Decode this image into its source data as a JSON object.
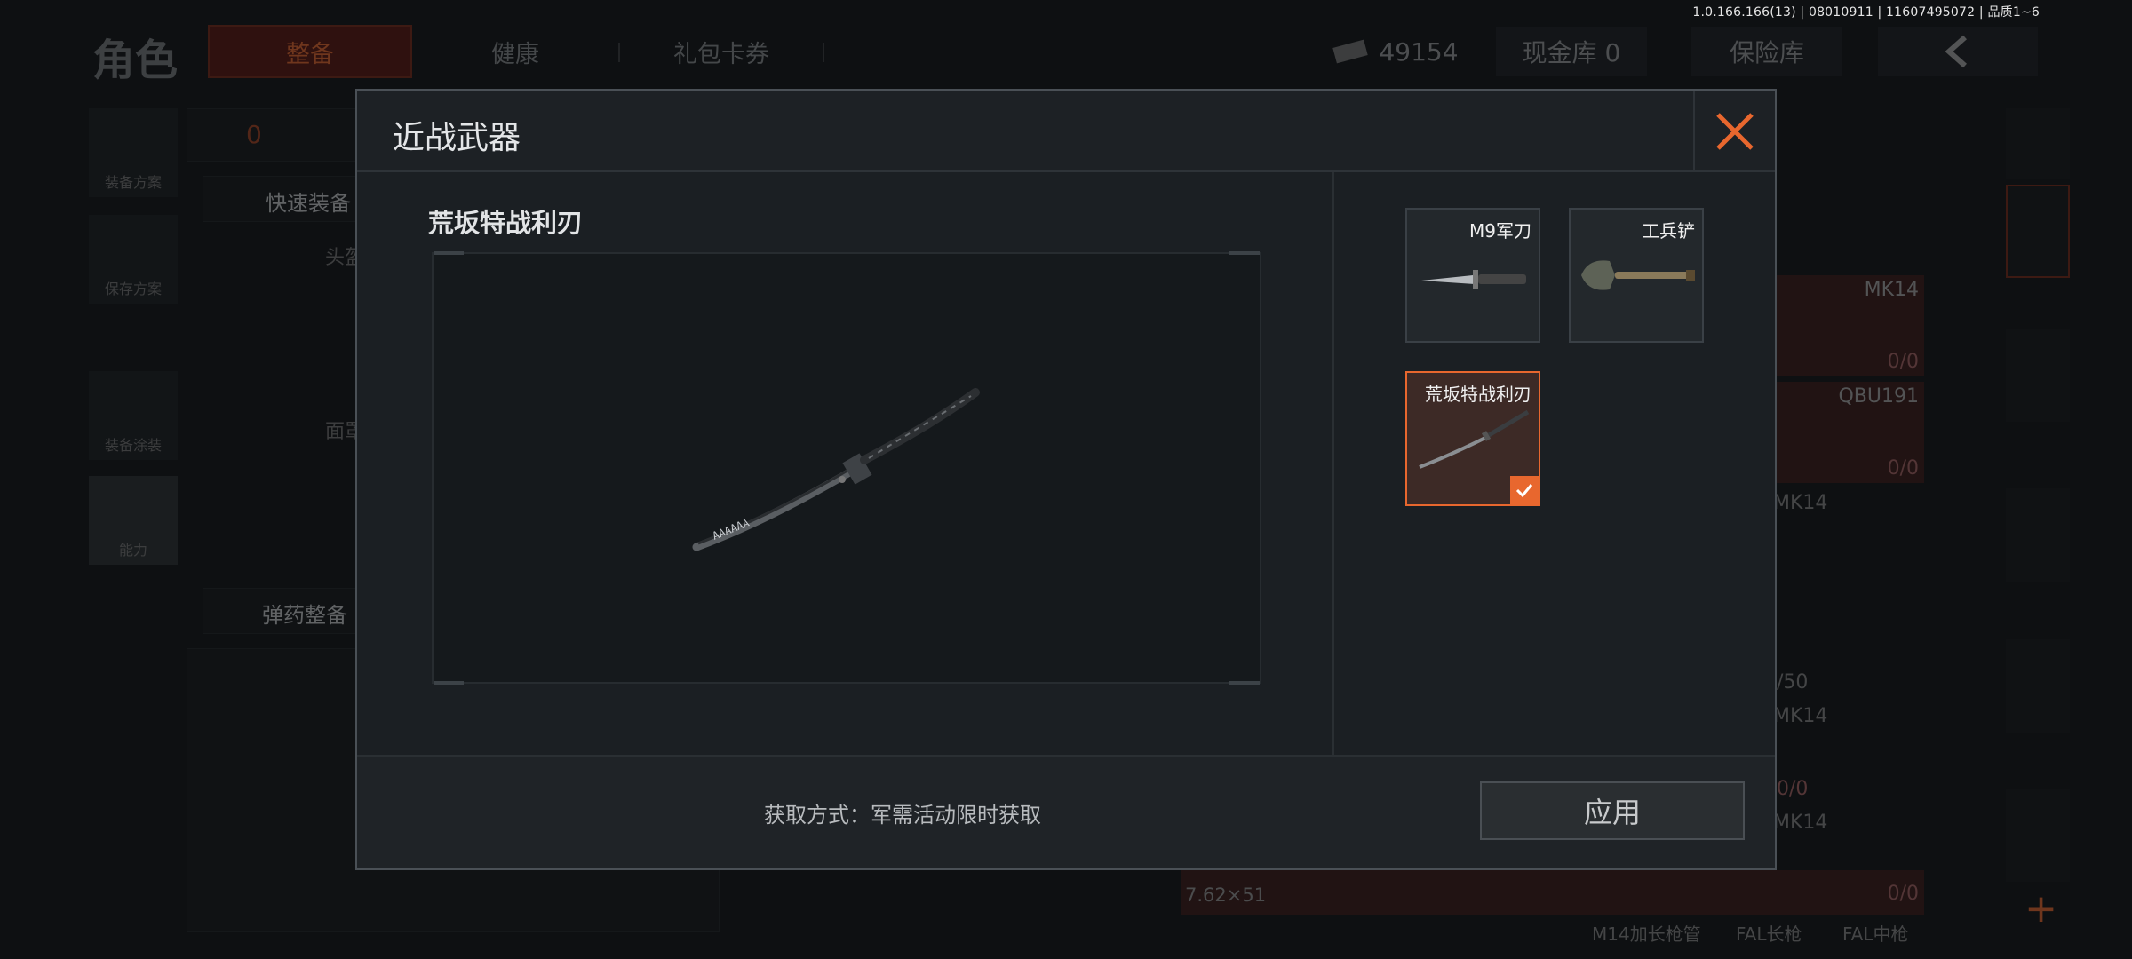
{
  "version": "1.0.166.166(13) | 08010911 | 11607495072 | 品质1~6",
  "topbar": {
    "title": "角色",
    "tabs": [
      "整备",
      "健康",
      "礼包卡券"
    ],
    "currency": "49154",
    "cash_vault": "现金库 0",
    "safe": "保险库"
  },
  "sidebar": {
    "items": [
      "装备方案",
      "保存方案",
      "装备涂装",
      "能力"
    ]
  },
  "background": {
    "quick_equip": "快速装备",
    "ammo_equip": "弹药整备",
    "slot_labels": [
      "头盔",
      "面罩"
    ],
    "count_zero": "0",
    "weapon_list": [
      {
        "name": "MK14",
        "count": "0/0"
      },
      {
        "name": "QBU191",
        "count": "0/0"
      },
      {
        "name": "MK14",
        "count": "/50"
      },
      {
        "name": "MK14",
        "count": "0/0"
      },
      {
        "name": "MK14",
        "count": "0/0"
      }
    ],
    "caliber": "7.62×51",
    "bottom_labels": [
      "M14加长枪管",
      "FAL长枪",
      "FAL中枪"
    ]
  },
  "modal": {
    "title": "近战武器",
    "preview_title": "荒坂特战利刃",
    "weapons": [
      {
        "name": "M9军刀",
        "icon": "knife-icon"
      },
      {
        "name": "工兵铲",
        "icon": "shovel-icon"
      },
      {
        "name": "荒坂特战利刃",
        "icon": "katana-icon",
        "selected": true
      }
    ],
    "acquire_text": "获取方式：军需活动限时获取",
    "apply_label": "应用"
  },
  "colors": {
    "accent": "#e8672e",
    "modal_bg": "#1b1f23",
    "selected_bg": "#3d2a26"
  }
}
